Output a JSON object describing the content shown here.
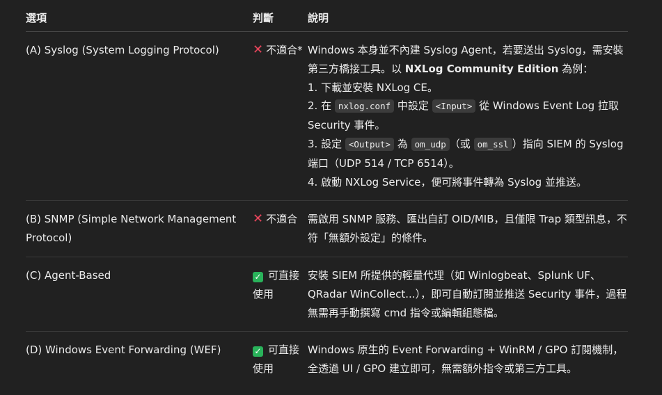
{
  "headers": {
    "option": "選項",
    "judgement": "判斷",
    "description": "說明"
  },
  "rows": [
    {
      "option": "(A) Syslog (System Logging Protocol)",
      "verdict": "不適合*",
      "verdict_icon": "cross-mark-icon",
      "desc": {
        "intro": "Windows 本身並不內建 Syslog Agent，若要送出 Syslog，需安裝第三方橋接工具。以 ",
        "bold": "NXLog Community Edition",
        "intro_end": " 為例：",
        "step1": "1. 下載並安裝 NXLog CE。",
        "step2_a": "2. 在 ",
        "step2_code1": "nxlog.conf",
        "step2_b": " 中設定 ",
        "step2_code2": "<Input>",
        "step2_c": " 從 Windows Event Log 拉取 Security 事件。",
        "step3_a": "3. 設定 ",
        "step3_code1": "<Output>",
        "step3_b": " 為 ",
        "step3_code2": "om_udp",
        "step3_c": "（或 ",
        "step3_code3": "om_ssl",
        "step3_d": "）指向 SIEM 的 Syslog 端口（UDP 514 / TCP 6514）。",
        "step4": "4. 啟動 NXLog Service，便可將事件轉為 Syslog 並推送。"
      }
    },
    {
      "option": "(B) SNMP (Simple Network Management Protocol)",
      "verdict": "不適合",
      "verdict_icon": "cross-mark-icon",
      "desc": "需啟用 SNMP 服務、匯出自訂 OID/MIB，且僅限 Trap 類型訊息，不符「無額外設定」的條件。"
    },
    {
      "option": "(C) Agent-Based",
      "verdict": "可直接使用",
      "verdict_icon": "check-mark-icon",
      "desc": "安裝 SIEM 所提供的輕量代理（如 Winlogbeat、Splunk UF、QRadar WinCollect...），即可自動訂閱並推送 Security 事件，過程無需再手動撰寫 cmd 指令或編輯組態檔。"
    },
    {
      "option": "(D) Windows Event Forwarding (WEF)",
      "verdict": "可直接使用",
      "verdict_icon": "check-mark-icon",
      "desc": "Windows 原生的 Event Forwarding + WinRM / GPO 訂閱機制，全透過 UI / GPO 建立即可，無需額外指令或第三方工具。"
    }
  ],
  "colors": {
    "background": "#212121",
    "text": "#ececec",
    "cross": "#e8455c",
    "check": "#29b25a",
    "code_bg": "#3c3c3c"
  }
}
